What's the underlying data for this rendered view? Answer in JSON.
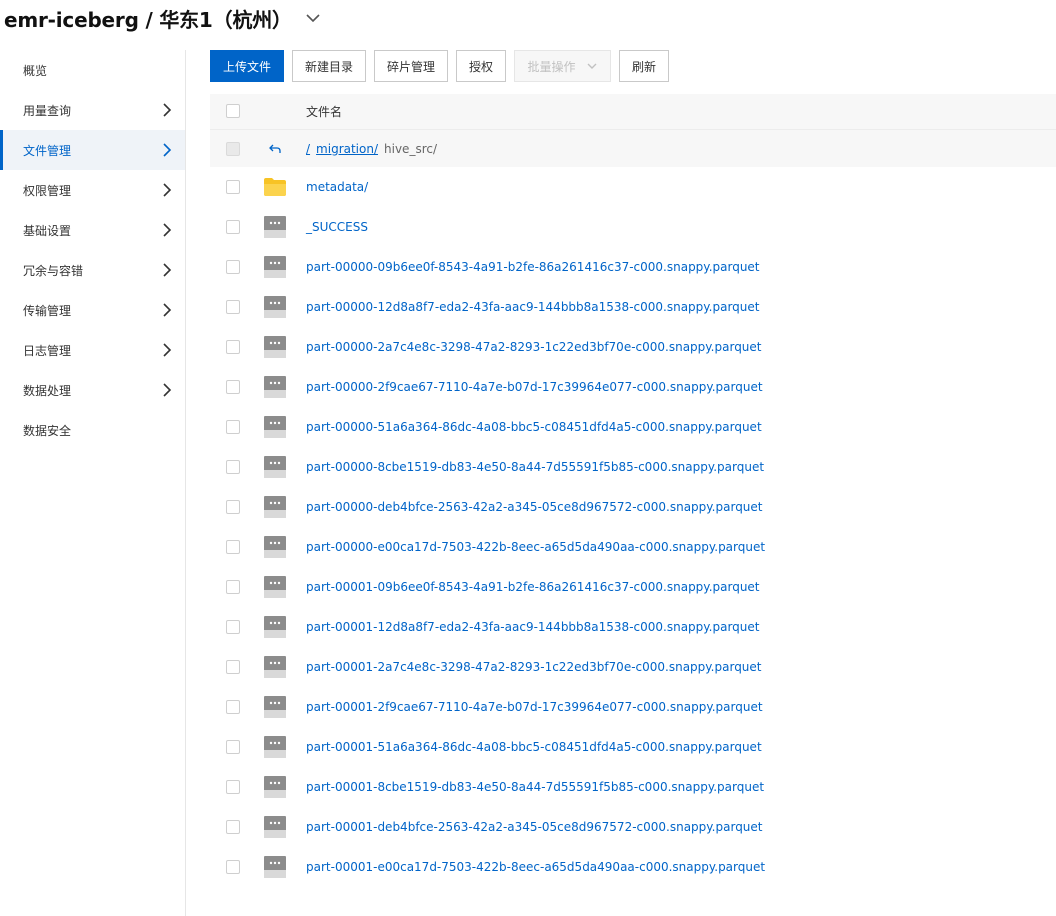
{
  "header": {
    "title": "emr-iceberg / 华东1（杭州）"
  },
  "sidebar": {
    "items": [
      {
        "label": "概览",
        "has_arrow": false,
        "active": false
      },
      {
        "label": "用量查询",
        "has_arrow": true,
        "active": false
      },
      {
        "label": "文件管理",
        "has_arrow": true,
        "active": true
      },
      {
        "label": "权限管理",
        "has_arrow": true,
        "active": false
      },
      {
        "label": "基础设置",
        "has_arrow": true,
        "active": false
      },
      {
        "label": "冗余与容错",
        "has_arrow": true,
        "active": false
      },
      {
        "label": "传输管理",
        "has_arrow": true,
        "active": false
      },
      {
        "label": "日志管理",
        "has_arrow": true,
        "active": false
      },
      {
        "label": "数据处理",
        "has_arrow": true,
        "active": false
      },
      {
        "label": "数据安全",
        "has_arrow": false,
        "active": false
      }
    ]
  },
  "toolbar": {
    "upload": "上传文件",
    "new_dir": "新建目录",
    "fragments": "碎片管理",
    "authorize": "授权",
    "batch": "批量操作",
    "refresh": "刷新"
  },
  "table": {
    "header_name": "文件名",
    "breadcrumb": {
      "root": "/",
      "dir": "migration/",
      "current": "hive_src/"
    },
    "files": [
      {
        "name": "metadata/",
        "type": "folder"
      },
      {
        "name": "_SUCCESS",
        "type": "file"
      },
      {
        "name": "part-00000-09b6ee0f-8543-4a91-b2fe-86a261416c37-c000.snappy.parquet",
        "type": "file"
      },
      {
        "name": "part-00000-12d8a8f7-eda2-43fa-aac9-144bbb8a1538-c000.snappy.parquet",
        "type": "file"
      },
      {
        "name": "part-00000-2a7c4e8c-3298-47a2-8293-1c22ed3bf70e-c000.snappy.parquet",
        "type": "file"
      },
      {
        "name": "part-00000-2f9cae67-7110-4a7e-b07d-17c39964e077-c000.snappy.parquet",
        "type": "file"
      },
      {
        "name": "part-00000-51a6a364-86dc-4a08-bbc5-c08451dfd4a5-c000.snappy.parquet",
        "type": "file"
      },
      {
        "name": "part-00000-8cbe1519-db83-4e50-8a44-7d55591f5b85-c000.snappy.parquet",
        "type": "file"
      },
      {
        "name": "part-00000-deb4bfce-2563-42a2-a345-05ce8d967572-c000.snappy.parquet",
        "type": "file"
      },
      {
        "name": "part-00000-e00ca17d-7503-422b-8eec-a65d5da490aa-c000.snappy.parquet",
        "type": "file"
      },
      {
        "name": "part-00001-09b6ee0f-8543-4a91-b2fe-86a261416c37-c000.snappy.parquet",
        "type": "file"
      },
      {
        "name": "part-00001-12d8a8f7-eda2-43fa-aac9-144bbb8a1538-c000.snappy.parquet",
        "type": "file"
      },
      {
        "name": "part-00001-2a7c4e8c-3298-47a2-8293-1c22ed3bf70e-c000.snappy.parquet",
        "type": "file"
      },
      {
        "name": "part-00001-2f9cae67-7110-4a7e-b07d-17c39964e077-c000.snappy.parquet",
        "type": "file"
      },
      {
        "name": "part-00001-51a6a364-86dc-4a08-bbc5-c08451dfd4a5-c000.snappy.parquet",
        "type": "file"
      },
      {
        "name": "part-00001-8cbe1519-db83-4e50-8a44-7d55591f5b85-c000.snappy.parquet",
        "type": "file"
      },
      {
        "name": "part-00001-deb4bfce-2563-42a2-a345-05ce8d967572-c000.snappy.parquet",
        "type": "file"
      },
      {
        "name": "part-00001-e00ca17d-7503-422b-8eec-a65d5da490aa-c000.snappy.parquet",
        "type": "file"
      }
    ]
  },
  "colors": {
    "accent": "#0064c8",
    "folder": "#f7c325",
    "file_icon": "#8c8c8c"
  }
}
